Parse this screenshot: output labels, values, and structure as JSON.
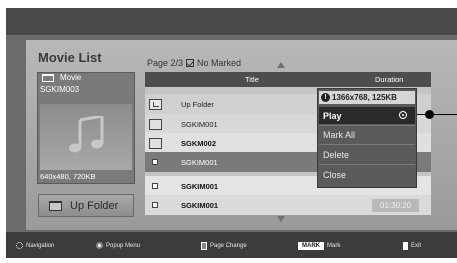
{
  "page": {
    "title": "Movie List",
    "page_info": "Page 2/3",
    "marked_label": "No Marked"
  },
  "info_panel": {
    "category": "Movie",
    "filename": "SGKIM003",
    "resolution": "640x480, 720KB"
  },
  "up_folder_button": {
    "label": "Up Folder"
  },
  "table": {
    "headers": {
      "title": "Title",
      "duration": "Duration"
    },
    "rows": [
      {
        "type": "up-folder",
        "name": "Up Folder",
        "duration": ""
      },
      {
        "type": "folder",
        "name": "SGKIM001",
        "duration": ""
      },
      {
        "type": "folder",
        "name": "SGKM002",
        "duration": ""
      },
      {
        "type": "file",
        "name": "SGKIM001",
        "duration": ""
      },
      {
        "type": "file",
        "name": "SGKIM001",
        "duration": ""
      },
      {
        "type": "file",
        "name": "SGKIM001",
        "duration": "01:30:20"
      }
    ]
  },
  "popup": {
    "header": "1366x768, 125KB",
    "items": [
      "Play",
      "Mark All",
      "Delete",
      "Close"
    ],
    "selected": "Play"
  },
  "footer": {
    "navigation": "Navigation",
    "popup_menu": "Popup Menu",
    "page_change": "Page Change",
    "mark_key": "MARK",
    "mark": "Mark",
    "exit": "Exit"
  },
  "colors": {
    "frame": "#6b6b6b",
    "panel": "#b0b0b0",
    "header": "#4d4d4d",
    "selected_row": "#7a7a7a",
    "popup_selected": "#2a2a2a"
  }
}
